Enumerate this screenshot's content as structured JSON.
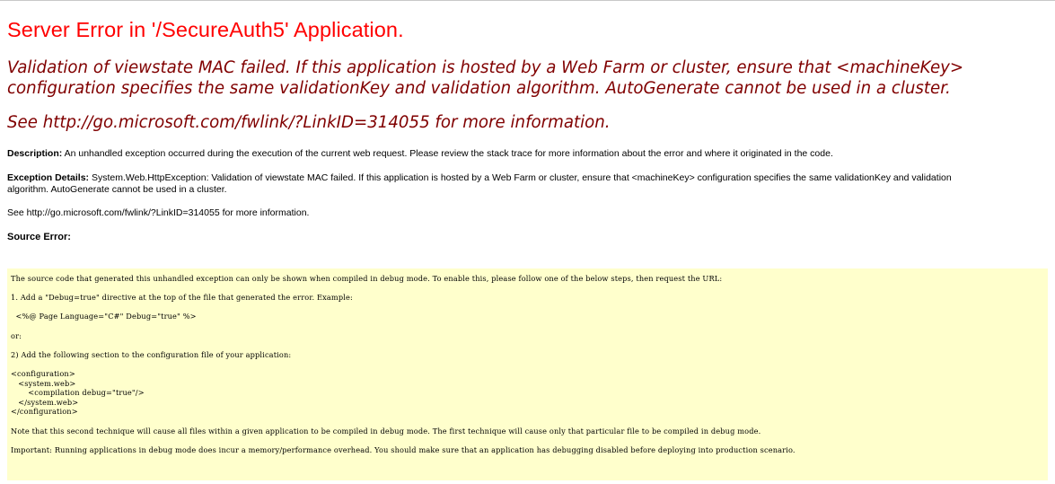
{
  "header": {
    "title": "Server Error in '/SecureAuth5' Application."
  },
  "error": {
    "message_lines": [
      "Validation of viewstate MAC failed. If this application is hosted by a Web Farm or cluster, ensure that <machineKey>",
      "configuration specifies the same validationKey and validation algorithm. AutoGenerate cannot be used in a cluster."
    ],
    "see_link": "See http://go.microsoft.com/fwlink/?LinkID=314055 for more information."
  },
  "description": {
    "label": "Description:",
    "text": "An unhandled exception occurred during the execution of the current web request. Please review the stack trace for more information about the error and where it originated in the code."
  },
  "exception_details": {
    "label": "Exception Details:",
    "line1": "System.Web.HttpException: Validation of viewstate MAC failed. If this application is hosted by a Web Farm or cluster, ensure that <machineKey> configuration specifies the same validationKey and validation",
    "line2": "algorithm. AutoGenerate cannot be used in a cluster."
  },
  "see_more": "See http://go.microsoft.com/fwlink/?LinkID=314055 for more information.",
  "source_error": {
    "label": "Source Error:",
    "intro": "The source code that generated this unhandled exception can only be shown when compiled in debug mode. To enable this, please follow one of the below steps, then request the URL:",
    "step1": "1. Add a \"Debug=true\" directive at the top of the file that generated the error. Example:",
    "step1_code": "  <%@ Page Language=\"C#\" Debug=\"true\" %>",
    "or": "or:",
    "step2": "2) Add the following section to the configuration file of your application:",
    "config_lines": [
      "<configuration>",
      "   <system.web>",
      "       <compilation debug=\"true\"/>",
      "   </system.web>",
      "</configuration>"
    ],
    "note": "Note that this second technique will cause all files within a given application to be compiled in debug mode. The first technique will cause only that particular file to be compiled in debug mode.",
    "important": "Important: Running applications in debug mode does incur a memory/performance overhead. You should make sure that an application has debugging disabled before deploying into production scenario."
  },
  "colors": {
    "title": "#ff0000",
    "error_message": "#800000",
    "source_background": "#ffffcc"
  }
}
